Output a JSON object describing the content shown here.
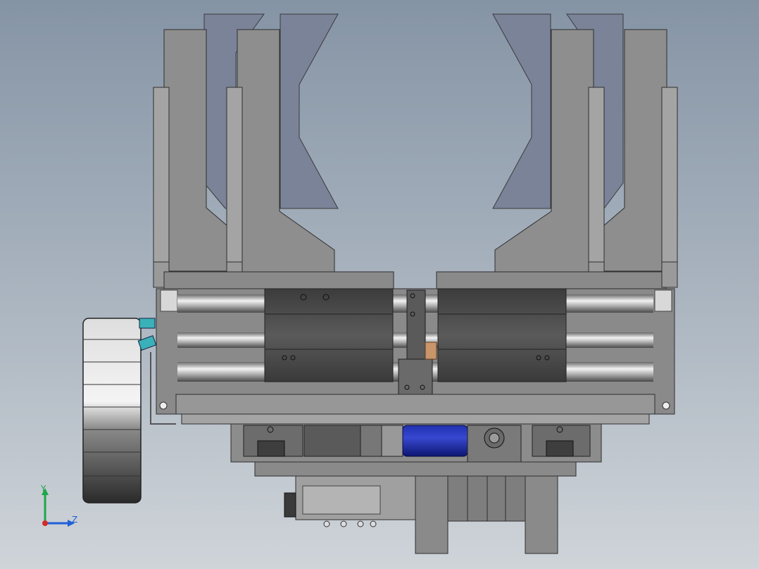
{
  "app": {
    "title": "",
    "view": "Front"
  },
  "axes_triad": {
    "y_label": "Y",
    "z_label": "Z",
    "y_color": "#1fa64a",
    "z_color": "#1f5fd6",
    "x_color": "#d42a2a"
  },
  "colors": {
    "background_top": "#8594a5",
    "background_bottom": "#cfd4d9",
    "part_gray": "#8c8c8c",
    "part_dark": "#5a5a5a",
    "finger_blue_gray": "#7b8399",
    "motor_blue": "#1a2aa0",
    "accent_bronze": "#c9956b",
    "fitting_cyan": "#3ab0b8"
  }
}
